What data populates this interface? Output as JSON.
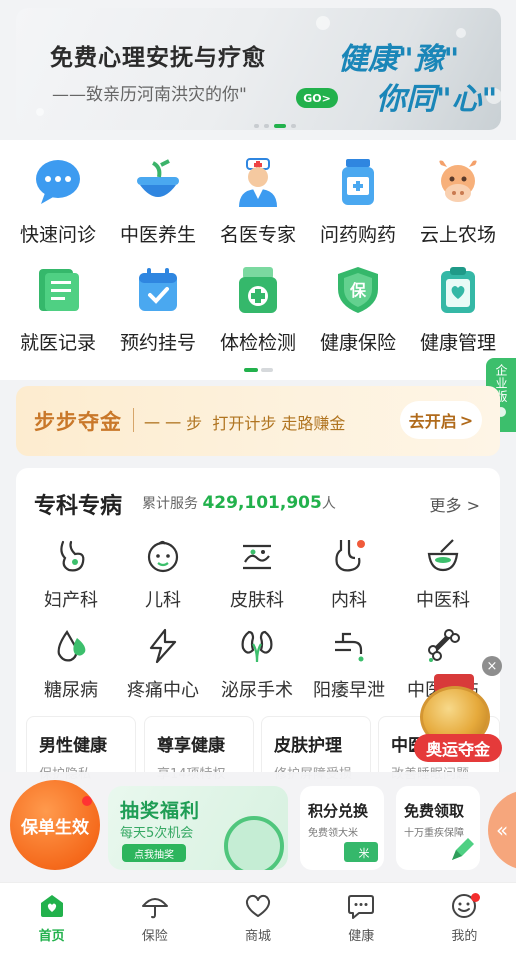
{
  "banner": {
    "title": "免费心理安抚与疗愈",
    "subtitle": "——致亲历河南洪灾的你\"",
    "go_label": "GO>",
    "slogan_line1": "健康\"豫\"",
    "slogan_line2": "你同\"心\""
  },
  "services": [
    {
      "label": "快速问诊",
      "icon": "chat-bubble-icon"
    },
    {
      "label": "中医养生",
      "icon": "herb-bowl-icon"
    },
    {
      "label": "名医专家",
      "icon": "doctor-icon"
    },
    {
      "label": "问药购药",
      "icon": "medicine-bottle-icon"
    },
    {
      "label": "云上农场",
      "icon": "cow-icon"
    },
    {
      "label": "就医记录",
      "icon": "record-icon"
    },
    {
      "label": "预约挂号",
      "icon": "calendar-icon"
    },
    {
      "label": "体检检测",
      "icon": "checkup-box-icon"
    },
    {
      "label": "健康保险",
      "icon": "shield-icon"
    },
    {
      "label": "健康管理",
      "icon": "clipboard-icon"
    }
  ],
  "enterprise_tab": {
    "label": "企业版"
  },
  "step_banner": {
    "title": "步步夺金",
    "desc": "一 一 步  打开计步 走路赚金",
    "button": "去开启",
    "button_arrow": ">"
  },
  "specialty": {
    "title": "专科专病",
    "stat_prefix": "累计服务",
    "stat_value": "429,101,905",
    "stat_suffix": "人",
    "more": "更多",
    "more_arrow": ">",
    "departments": [
      {
        "label": "妇产科",
        "icon": "uterus-icon"
      },
      {
        "label": "儿科",
        "icon": "baby-face-icon"
      },
      {
        "label": "皮肤科",
        "icon": "skin-icon"
      },
      {
        "label": "内科",
        "icon": "stomach-icon"
      },
      {
        "label": "中医科",
        "icon": "mortar-icon"
      },
      {
        "label": "糖尿病",
        "icon": "drop-icon"
      },
      {
        "label": "疼痛中心",
        "icon": "lightning-icon"
      },
      {
        "label": "泌尿手术",
        "icon": "kidney-icon"
      },
      {
        "label": "阳痿早泄",
        "icon": "faucet-icon"
      },
      {
        "label": "中医骨伤",
        "icon": "bone-icon"
      }
    ],
    "cards": [
      {
        "title": "男性健康",
        "sub": "保护隐私"
      },
      {
        "title": "尊享健康",
        "sub": "享14项特权"
      },
      {
        "title": "皮肤护理",
        "sub": "修护屏障受损"
      },
      {
        "title": "中医",
        "sub": "改善睡眠问题"
      }
    ]
  },
  "medal": {
    "label": "奥运夺金",
    "close": "×"
  },
  "promo": {
    "circle_label": "保单生效",
    "lottery_title": "抽奖福利",
    "lottery_sub": "每天5次机会",
    "lottery_btn": "点我抽奖",
    "points_title": "积分兑换",
    "points_sub": "免费领大米",
    "free_title": "免费领取",
    "free_sub": "十万重疾保障",
    "side_arrow": "«"
  },
  "tabs": [
    {
      "label": "首页",
      "icon": "home-icon",
      "active": true
    },
    {
      "label": "保险",
      "icon": "umbrella-icon"
    },
    {
      "label": "商城",
      "icon": "heart-icon"
    },
    {
      "label": "健康",
      "icon": "chat-icon"
    },
    {
      "label": "我的",
      "icon": "smile-icon"
    }
  ],
  "colors": {
    "brand_green": "#22b14c",
    "step_orange": "#c9782a",
    "medal_red": "#e53a3a"
  }
}
